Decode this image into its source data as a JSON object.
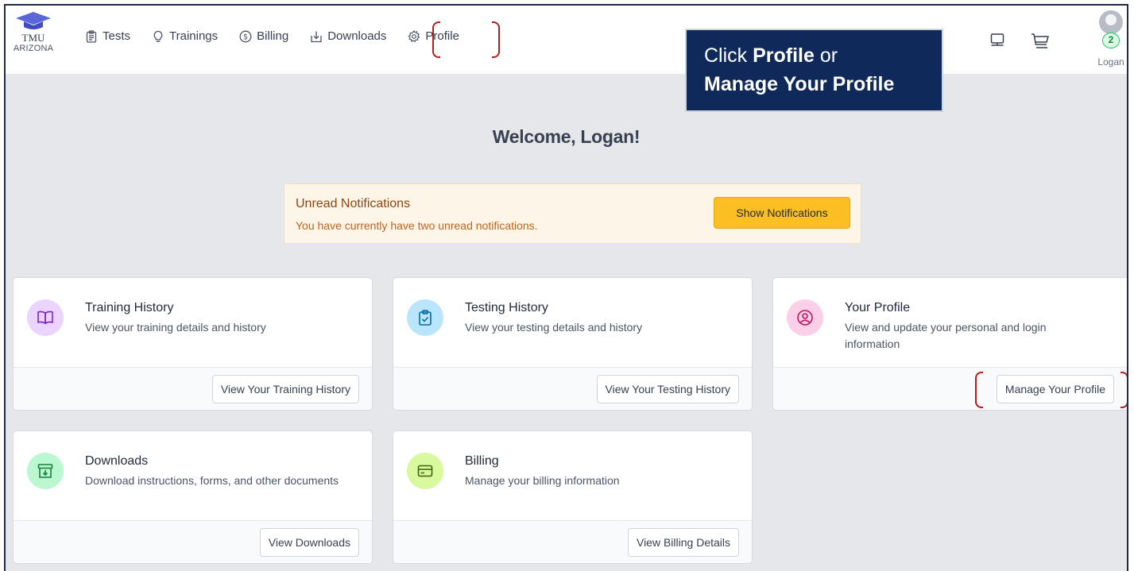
{
  "header": {
    "logo": {
      "line1": "TMU",
      "line2": "ARIZONA"
    },
    "nav": [
      {
        "label": "Tests",
        "icon": "clipboard-icon"
      },
      {
        "label": "Trainings",
        "icon": "lightbulb-icon"
      },
      {
        "label": "Billing",
        "icon": "dollar-circle-icon"
      },
      {
        "label": "Downloads",
        "icon": "download-tray-icon"
      },
      {
        "label": "Profile",
        "icon": "gear-icon"
      }
    ],
    "icons": [
      "monitor-icon",
      "cart-icon"
    ],
    "user": {
      "name": "Logan",
      "notification_count": "2"
    }
  },
  "callout": {
    "line1_prefix": "Click ",
    "line1_bold": "Profile",
    "line1_suffix": " or",
    "line2_bold": "Manage Your Profile"
  },
  "welcome": "Welcome, Logan!",
  "notification": {
    "title": "Unread Notifications",
    "message": "You have currently have two unread notifications.",
    "button": "Show Notifications"
  },
  "cards": [
    {
      "title": "Training History",
      "desc": "View your training details and history",
      "button": "View Your Training History",
      "icon": "book-icon",
      "icon_bg": "#e9d5ff",
      "icon_color": "#7e22ce"
    },
    {
      "title": "Testing History",
      "desc": "View your testing details and history",
      "button": "View Your Testing History",
      "icon": "clipboard-check-icon",
      "icon_bg": "#bae6fd",
      "icon_color": "#0369a1"
    },
    {
      "title": "Your Profile",
      "desc": "View and update your personal and login information",
      "button": "Manage Your Profile",
      "icon": "user-circle-icon",
      "icon_bg": "#fbcfe8",
      "icon_color": "#be185d"
    },
    {
      "title": "Downloads",
      "desc": "Download instructions, forms, and other documents",
      "button": "View Downloads",
      "icon": "archive-download-icon",
      "icon_bg": "#bbf7d0",
      "icon_color": "#15803d"
    },
    {
      "title": "Billing",
      "desc": "Manage your billing information",
      "button": "View Billing Details",
      "icon": "credit-card-icon",
      "icon_bg": "#d9f99d",
      "icon_color": "#3f6212"
    }
  ],
  "colors": {
    "accent": "#fbbf24",
    "callout_bg": "#0f2a5a",
    "highlight": "#b91c1c"
  }
}
